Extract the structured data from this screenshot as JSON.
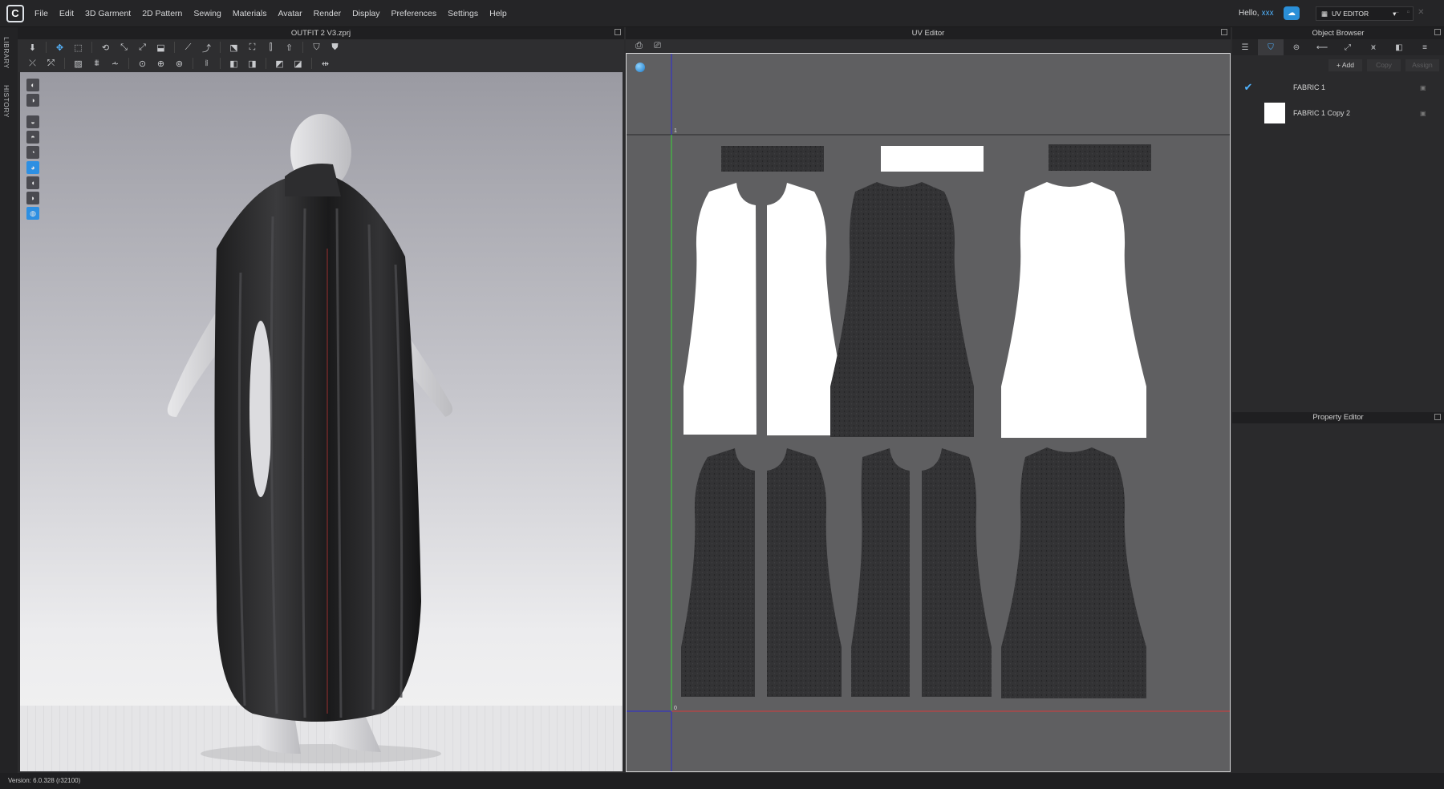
{
  "app": {
    "logo": "C"
  },
  "menubar": {
    "items": [
      "File",
      "Edit",
      "3D Garment",
      "2D Pattern",
      "Sewing",
      "Materials",
      "Avatar",
      "Render",
      "Display",
      "Preferences",
      "Settings",
      "Help"
    ],
    "hello": "Hello,",
    "user": "xxx",
    "mode_label": "UV EDITOR"
  },
  "sidebar_tabs": {
    "library": "LIBRARY",
    "history": "HISTORY"
  },
  "viewport3d": {
    "title": "OUTFIT 2 V3.zprj"
  },
  "uv_editor": {
    "title": "UV Editor",
    "axis_label_top": "1",
    "axis_label_origin": "0",
    "colors": {
      "fabric_dark": "#333335",
      "fabric_white": "#ffffff",
      "background": "#5f5f61",
      "x_axis": "#d43b3b",
      "y_axis": "#3bd43b",
      "upper_axis": "#2b2bd6"
    }
  },
  "object_browser": {
    "title": "Object Browser",
    "add_label": "+ Add",
    "copy_label": "Copy",
    "assign_label": "Assign",
    "fabrics": [
      {
        "name": "FABRIC 1",
        "selected": true
      },
      {
        "name": "FABRIC 1 Copy 2",
        "selected": false
      }
    ]
  },
  "property_editor": {
    "title": "Property Editor"
  },
  "status": {
    "version": "Version: 6.0.328 (r32100)"
  }
}
